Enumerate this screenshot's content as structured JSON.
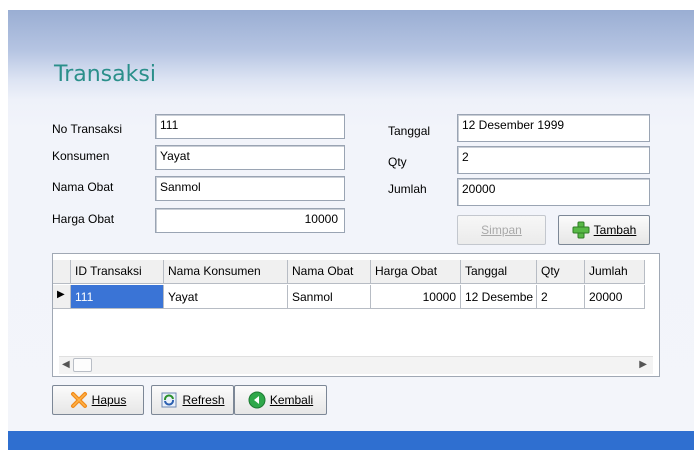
{
  "window": {
    "title": "Transaksi"
  },
  "fields": {
    "no_transaksi": {
      "label": "No Transaksi",
      "value": "111"
    },
    "konsumen": {
      "label": "Konsumen",
      "value": "Yayat"
    },
    "nama_obat": {
      "label": "Nama Obat",
      "value": "Sanmol"
    },
    "harga_obat": {
      "label": "Harga Obat",
      "value": "10000"
    },
    "tanggal": {
      "label": "Tanggal",
      "value": "12 Desember 1999"
    },
    "qty": {
      "label": "Qty",
      "value": "2"
    },
    "jumlah": {
      "label": "Jumlah",
      "value": "20000"
    }
  },
  "buttons": {
    "simpan": "Simpan",
    "tambah": "Tambah",
    "hapus": "Hapus",
    "refresh": "Refresh",
    "kembali": "Kembali"
  },
  "table": {
    "columns": [
      "ID Transaksi",
      "Nama Konsumen",
      "Nama Obat",
      "Harga Obat",
      "Tanggal",
      "Qty",
      "Jumlah"
    ],
    "rows": [
      [
        "111",
        "Yayat",
        "Sanmol",
        "10000",
        "12 Desembe",
        "2",
        "20000"
      ]
    ],
    "row_indicator": "▶"
  },
  "colors": {
    "title": "#2a8f8a",
    "footer": "#2f6fd0",
    "selection": "#3a74d6"
  },
  "icons": {
    "tambah": "plus-icon",
    "hapus": "delete-icon",
    "refresh": "refresh-icon",
    "kembali": "back-icon"
  }
}
